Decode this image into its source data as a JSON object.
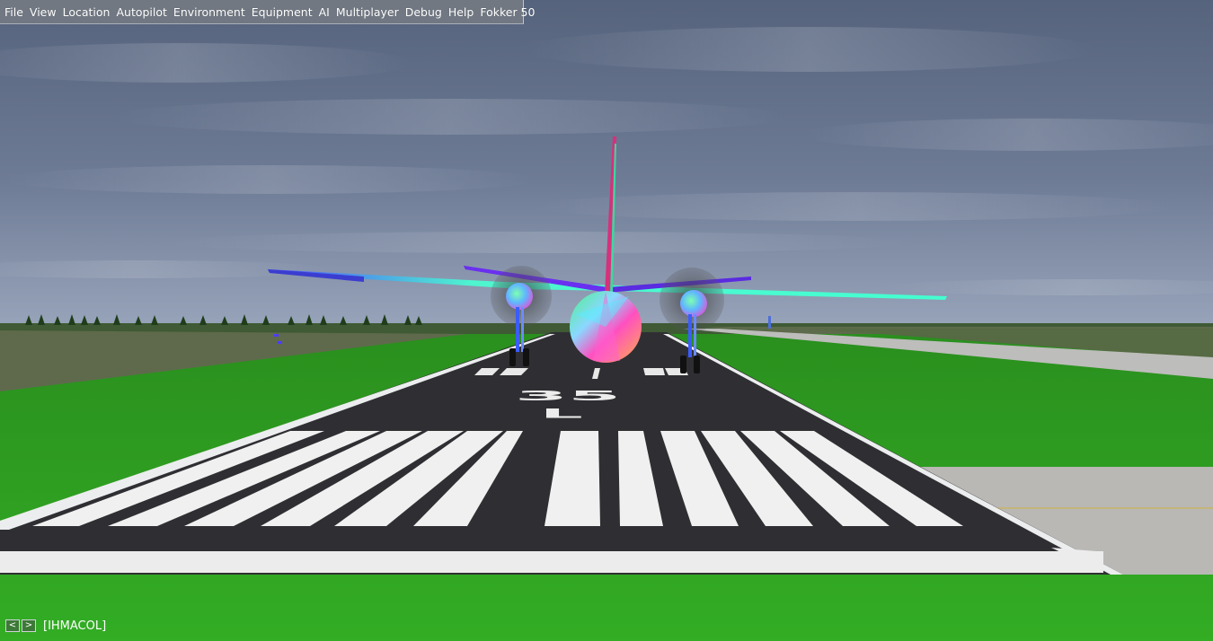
{
  "menubar": {
    "items": [
      "File",
      "View",
      "Location",
      "Autopilot",
      "Environment",
      "Equipment",
      "AI",
      "Multiplayer",
      "Debug",
      "Help",
      "Fokker 50"
    ]
  },
  "runway": {
    "number_top": "35",
    "number_bottom": "L"
  },
  "statusbar": {
    "prev_label": "<",
    "next_label": ">",
    "callsign": "[IHMACOL]"
  },
  "colors": {
    "sky_top": "#5d6b86",
    "sky_horizon": "#8d99b0",
    "grass": "#2fa522",
    "asphalt": "#2c2c30",
    "marking": "#f2f2f2",
    "menubar": "#7c8186"
  }
}
